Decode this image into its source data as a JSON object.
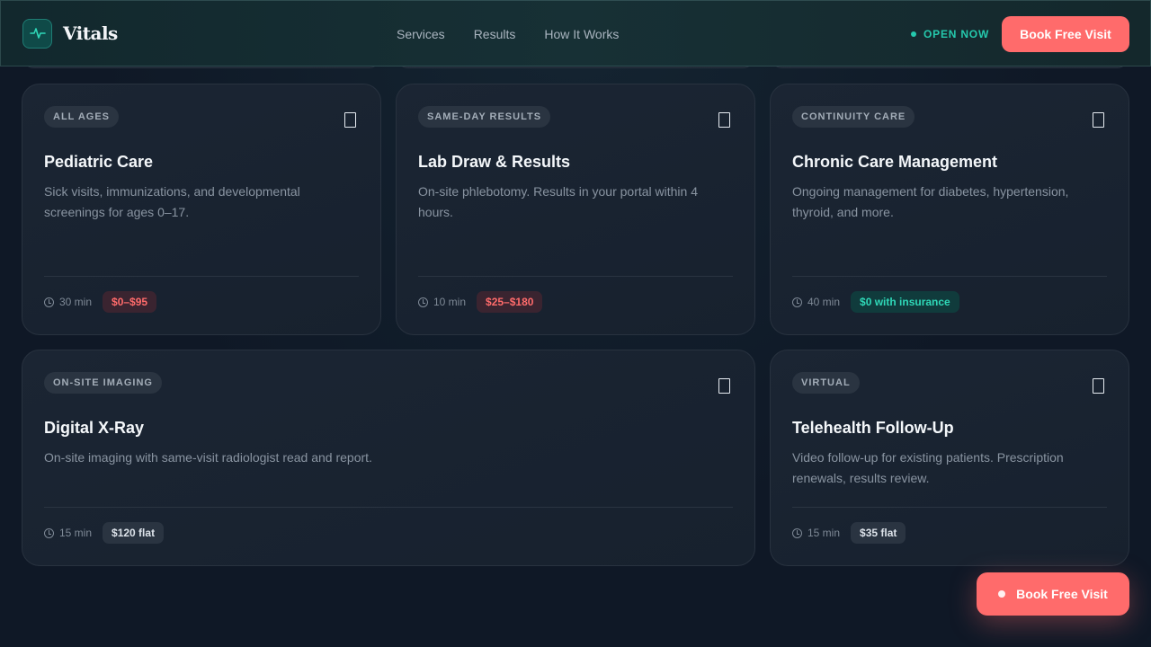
{
  "header": {
    "logo_text": "Vitals",
    "logo_icon": "pulse-icon",
    "nav": [
      "Services",
      "Results",
      "How It Works"
    ],
    "status": "OPEN NOW",
    "book_label": "Book Free Visit"
  },
  "cards": [
    {
      "tag": "ALL AGES",
      "title": "Pediatric Care",
      "desc": "Sick visits, immunizations, and developmental screenings for ages 0–17.",
      "duration": "30 min",
      "price": "$0–$95",
      "price_style": "red"
    },
    {
      "tag": "SAME-DAY RESULTS",
      "title": "Lab Draw & Results",
      "desc": "On-site phlebotomy. Results in your portal within 4 hours.",
      "duration": "10 min",
      "price": "$25–$180",
      "price_style": "red"
    },
    {
      "tag": "CONTINUITY CARE",
      "title": "Chronic Care Management",
      "desc": "Ongoing management for diabetes, hypertension, thyroid, and more.",
      "duration": "40 min",
      "price": "$0 with insurance",
      "price_style": "green"
    },
    {
      "tag": "ON-SITE IMAGING",
      "title": "Digital X-Ray",
      "desc": "On-site imaging with same-visit radiologist read and report.",
      "duration": "15 min",
      "price": "$120 flat",
      "price_style": "neutral"
    },
    {
      "tag": "VIRTUAL",
      "title": "Telehealth Follow-Up",
      "desc": "Video follow-up for existing patients. Prescription renewals, results review.",
      "duration": "15 min",
      "price": "$35 flat",
      "price_style": "neutral"
    }
  ],
  "floating_button": {
    "label": "Book Free Visit"
  },
  "colors": {
    "accent": "#ff6b6b",
    "teal": "#25c9ad",
    "background": "#0f1826"
  }
}
